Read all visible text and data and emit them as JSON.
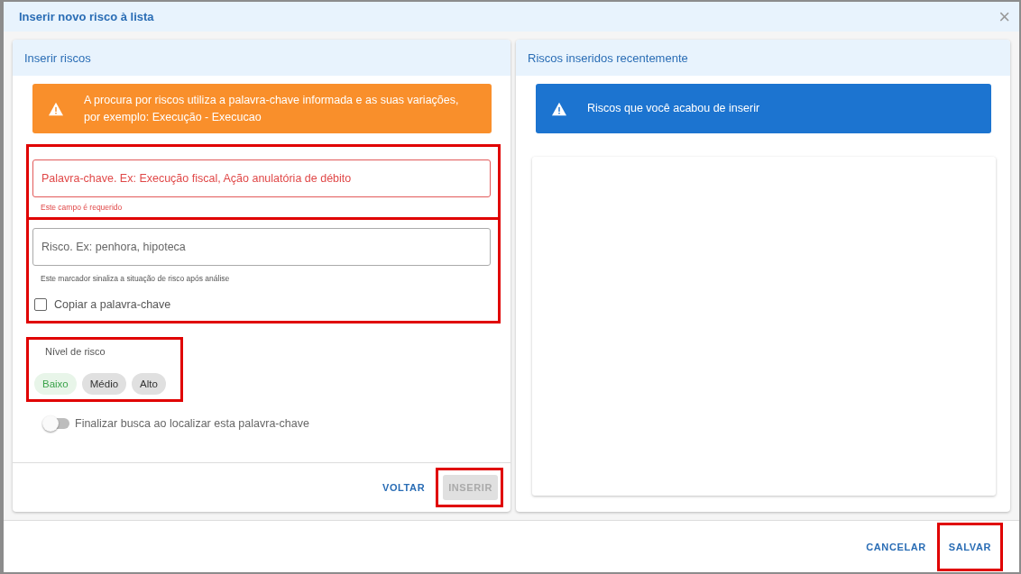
{
  "dialog": {
    "title": "Inserir novo risco à lista",
    "close_icon": "×"
  },
  "left_panel": {
    "title": "Inserir riscos",
    "alert": {
      "text": "A procura por riscos utiliza a palavra-chave informada e as suas variações, por exemplo: Execução - Execucao"
    },
    "keyword_field": {
      "placeholder": "Palavra-chave. Ex: Execução fiscal, Ação anulatória de débito",
      "error": "Este campo é requerido"
    },
    "risk_field": {
      "placeholder": "Risco. Ex: penhora, hipoteca",
      "hint": "Este marcador sinaliza a situação de risco após análise"
    },
    "copy_keyword": {
      "label": "Copiar a palavra-chave",
      "checked": false
    },
    "risk_level": {
      "label": "Nível de risco",
      "options": [
        {
          "label": "Baixo",
          "selected": true
        },
        {
          "label": "Médio",
          "selected": false
        },
        {
          "label": "Alto",
          "selected": false
        }
      ]
    },
    "finish_search": {
      "label": "Finalizar busca ao localizar esta palavra-chave",
      "on": false
    },
    "buttons": [
      {
        "label": "VOLTAR",
        "disabled": false
      },
      {
        "label": "INSERIR",
        "disabled": true
      }
    ]
  },
  "right_panel": {
    "title": "Riscos inseridos recentemente",
    "alert": {
      "text": "Riscos que você acabou de inserir"
    }
  },
  "footer_buttons": [
    {
      "label": "CANCELAR"
    },
    {
      "label": "SALVAR"
    }
  ]
}
